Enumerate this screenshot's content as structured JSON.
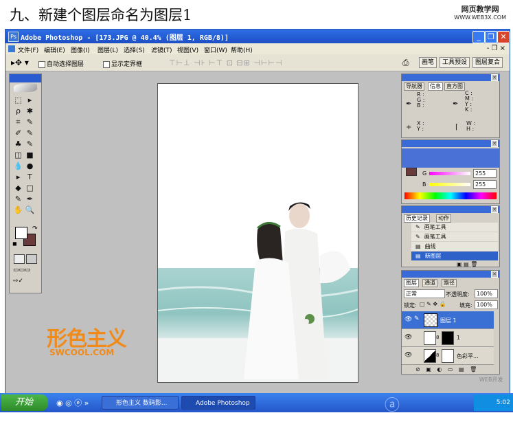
{
  "heading": "九、新建个图层命名为图层1",
  "site_logo": {
    "line1": "网页教学网",
    "line2": "WWW.WEB3X.COM"
  },
  "window": {
    "title": "Adobe Photoshop - [173.JPG @ 40.4% (图层 1, RGB/8)]",
    "minimize": "_",
    "restore": "❐",
    "close": "✕"
  },
  "menu": {
    "items": [
      "文件(F)",
      "编辑(E)",
      "图像(I)",
      "图层(L)",
      "选择(S)",
      "滤镜(T)",
      "视图(V)",
      "窗口(W)",
      "帮助(H)"
    ],
    "doc_controls": "- ❐ ×"
  },
  "options": {
    "auto_select": "自动选择图层",
    "show_bounds": "显示定界框",
    "tabs": [
      "画笔",
      "工具预设",
      "图层复合"
    ]
  },
  "toolbox": {
    "tools": [
      "⬚",
      "▸",
      "ρ",
      "✱",
      "⌗",
      "✎",
      "✐",
      "✎",
      "♣",
      "✎",
      "◫",
      "■",
      "💧",
      "●",
      "▸",
      "T",
      "◆",
      "□",
      "✎",
      "✒",
      "✋",
      "🔍"
    ]
  },
  "watermark": {
    "brand": "形色主义",
    "url": "SWCOOL.COM"
  },
  "nav_panel": {
    "tabs": [
      "导航器",
      "信息",
      "直方图"
    ],
    "rgb": [
      "R :",
      "G :",
      "B :"
    ],
    "cmyk": [
      "C :",
      "M :",
      "Y :",
      "K :"
    ],
    "xy": [
      "X :",
      "Y :"
    ],
    "wh": [
      "W :",
      "H :"
    ]
  },
  "color_panel": {
    "g_label": "G",
    "g_value": "255",
    "b_label": "B",
    "b_value": "255"
  },
  "history_panel": {
    "tabs": [
      "历史记录",
      "动作"
    ],
    "items": [
      "画笔工具",
      "画笔工具",
      "曲线",
      "新图层"
    ]
  },
  "layers_panel": {
    "tabs": [
      "图层",
      "通道",
      "路径"
    ],
    "blend_mode": "正常",
    "opacity_label": "不透明度:",
    "opacity": "100%",
    "lock_label": "锁定:",
    "fill_label": "填充:",
    "fill": "100%",
    "layers": [
      "图层 1",
      "1",
      "色彩平..."
    ]
  },
  "taskbar": {
    "start": "开始",
    "tasks": [
      "形色主义 数码影...",
      "Adobe Photoshop ..."
    ],
    "clock": "5:02",
    "tray_watermark": "WEB开发"
  },
  "colors": {
    "titlebar": "#1d4fc4",
    "taskbar": "#2456c8",
    "highlight": "#2f62c8",
    "watermark": "#f08a1a"
  }
}
